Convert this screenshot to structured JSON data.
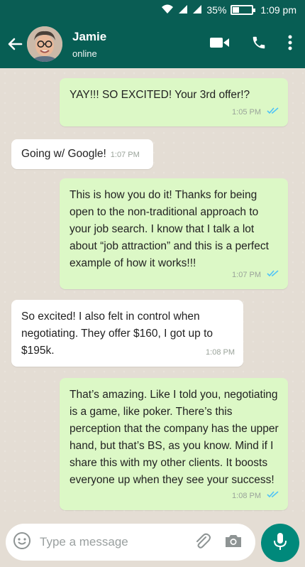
{
  "status_bar": {
    "battery": "35%",
    "time": "1:09 pm"
  },
  "header": {
    "contact_name": "Jamie",
    "contact_status": "online"
  },
  "messages": [
    {
      "text": "YAY!!! SO EXCITED! Your 3rd offer!?",
      "time": "1:05 PM",
      "direction": "outgoing",
      "read": true
    },
    {
      "text": "Going w/ Google!",
      "time": "1:07 PM",
      "direction": "incoming"
    },
    {
      "text": "This is how you do it! Thanks for being open to the non-traditional approach to your job search. I know that I talk a lot about “job attraction” and this is a perfect example of how it works!!!",
      "time": "1:07 PM",
      "direction": "outgoing",
      "read": true
    },
    {
      "text": "So excited! I also felt in control when negotiating. They offer $160, I got up to $195k.",
      "time": "1:08 PM",
      "direction": "incoming"
    },
    {
      "text": "That’s amazing. Like I told you, negotiating is a game, like poker. There’s this perception that the company has the upper hand, but that’s BS, as you know. Mind if I share this with my other clients. It boosts everyone up when they see your success!",
      "time": "1:08 PM",
      "direction": "outgoing",
      "read": true
    }
  ],
  "composer": {
    "placeholder": "Type a message"
  },
  "icons": [
    "wifi-icon",
    "signal-icon",
    "battery-icon",
    "back-arrow-icon",
    "video-call-icon",
    "phone-icon",
    "more-icon",
    "read-receipt-icon",
    "emoji-icon",
    "attach-icon",
    "camera-icon",
    "mic-icon"
  ],
  "colors": {
    "header": "#075e54",
    "outgoing_bubble": "#dcf8c6",
    "incoming_bubble": "#ffffff",
    "read_ticks": "#4fc3f7",
    "mic_button": "#00897b",
    "chat_background": "#e4ddd4"
  }
}
